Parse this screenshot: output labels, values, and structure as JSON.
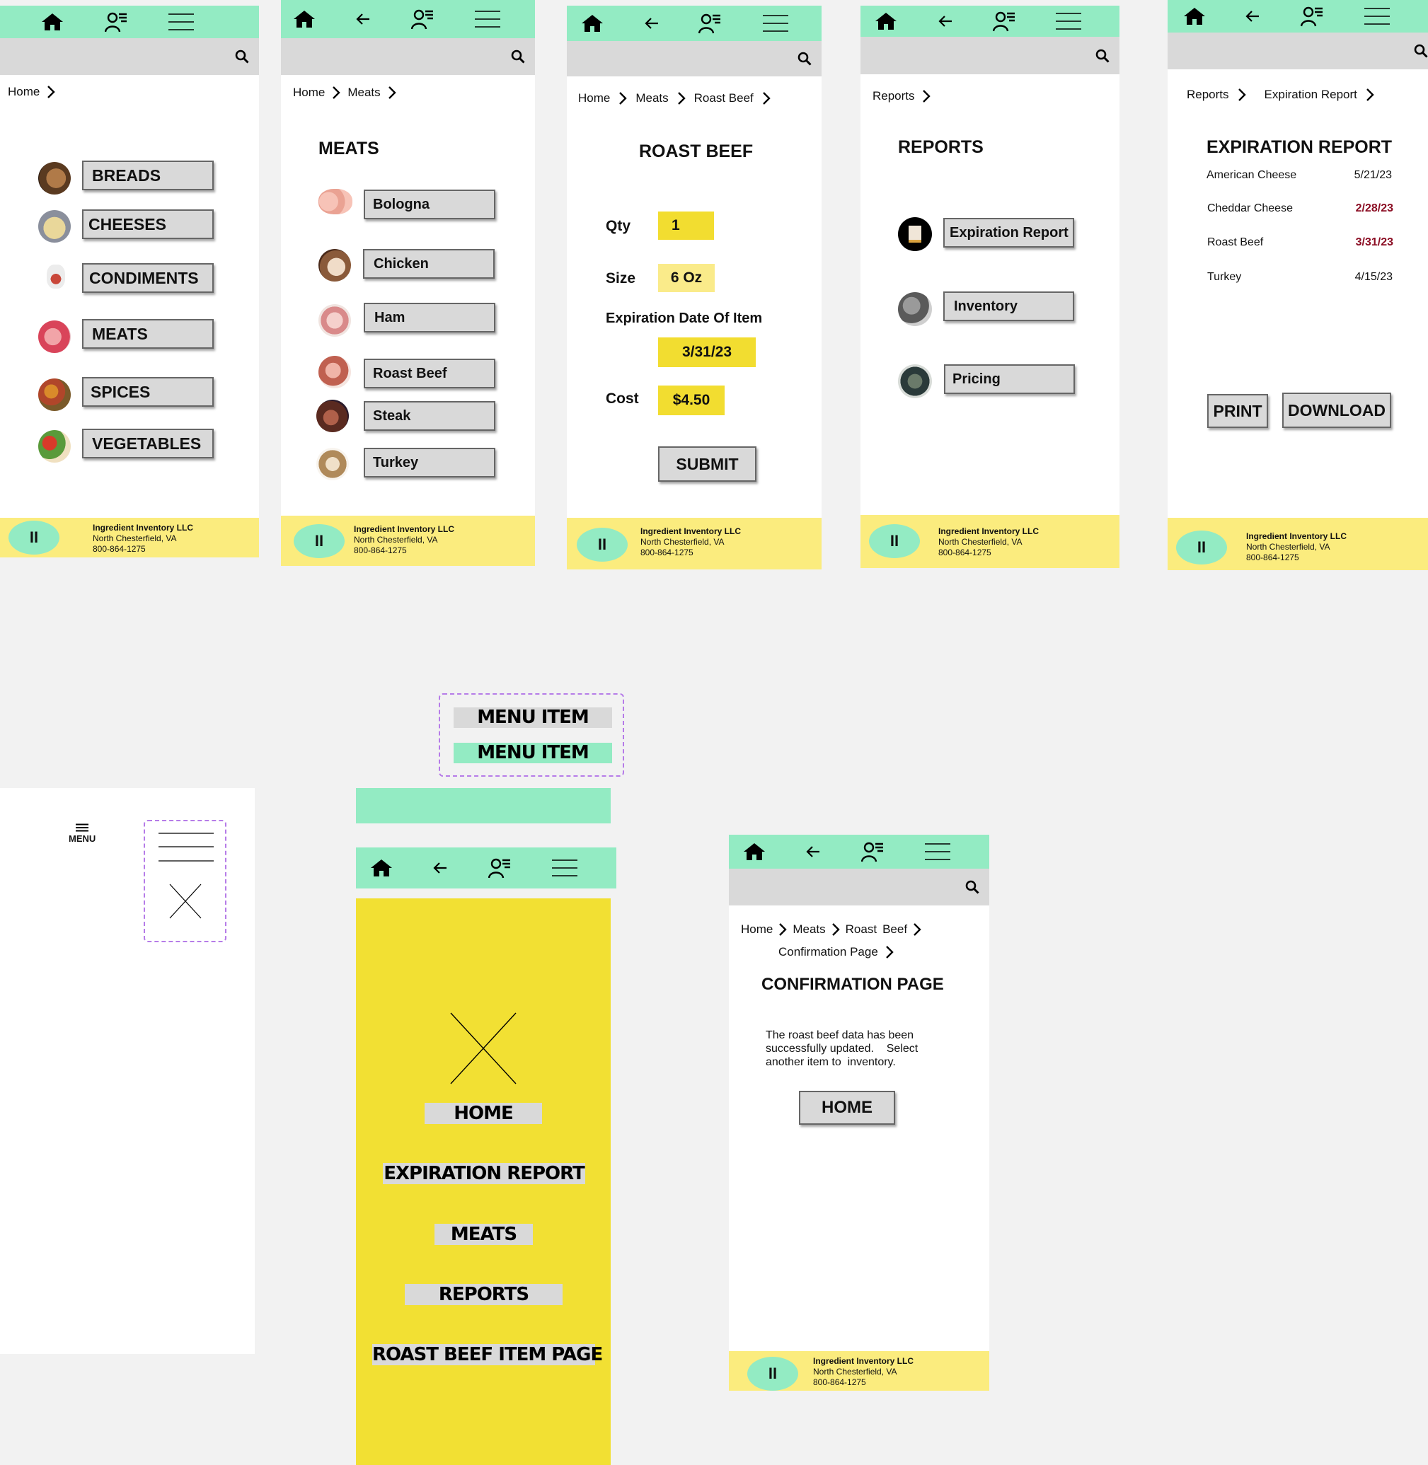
{
  "footer": {
    "company": "Ingredient Inventory LLC",
    "city": "North Chesterfield, VA",
    "phone": "800-864-1275",
    "pause_glyph": "II"
  },
  "home_screen": {
    "crumbs": [
      "Home"
    ],
    "categories": [
      "BREADS",
      "CHEESES",
      "CONDIMENTS",
      "MEATS",
      "SPICES",
      "VEGETABLES"
    ]
  },
  "meats_screen": {
    "crumbs": [
      "Home",
      "Meats"
    ],
    "title": "MEATS",
    "items": [
      "Bologna",
      "Chicken",
      "Ham",
      "Roast Beef",
      "Steak",
      "Turkey"
    ]
  },
  "roast_beef_screen": {
    "crumbs": [
      "Home",
      "Meats",
      "Roast Beef"
    ],
    "title": "ROAST BEEF",
    "qty_label": "Qty",
    "qty_value": "1",
    "size_label": "Size",
    "size_value": "6 Oz",
    "exp_label": "Expiration Date Of Item",
    "exp_value": "3/31/23",
    "cost_label": "Cost",
    "cost_value": "$4.50",
    "submit_label": "SUBMIT"
  },
  "reports_screen": {
    "crumbs": [
      "Reports"
    ],
    "title": "REPORTS",
    "items": [
      "Expiration Report",
      "Inventory",
      "Pricing"
    ]
  },
  "expiration_screen": {
    "crumbs": [
      "Reports",
      "Expiration Report"
    ],
    "title": "EXPIRATION REPORT",
    "rows": [
      {
        "item": "American Cheese",
        "date": "5/21/23",
        "flag": false
      },
      {
        "item": "Cheddar Cheese",
        "date": "2/28/23",
        "flag": true
      },
      {
        "item": "Roast Beef",
        "date": "3/31/23",
        "flag": true
      },
      {
        "item": "Turkey",
        "date": "4/15/23",
        "flag": false
      }
    ],
    "print_label": "PRINT",
    "download_label": "DOWNLOAD"
  },
  "menu_component": {
    "items": [
      "MENU ITEM",
      "MENU ITEM"
    ]
  },
  "menu_icon_frame": {
    "menu_label": "MENU"
  },
  "menu_overlay": {
    "items": [
      "HOME",
      "EXPIRATION REPORT",
      "MEATS",
      "REPORTS",
      "ROAST BEEF ITEM PAGE"
    ]
  },
  "confirmation_screen": {
    "crumbs_line1": [
      "Home",
      "Meats",
      "Roast",
      "Beef"
    ],
    "crumbs_line2": "Confirmation Page",
    "title": "CONFIRMATION PAGE",
    "message": "The roast beef data has been successfully updated.    Select another item to  inventory.",
    "home_label": "HOME"
  },
  "colors": {
    "nav_green": "#93ebc3",
    "search_gray": "#d9d9d9",
    "footer_yellow": "#fbec7e",
    "field_yellow": "#f2dd30",
    "alert_red": "#8b0d23",
    "dash_purple": "#b67ce8"
  }
}
